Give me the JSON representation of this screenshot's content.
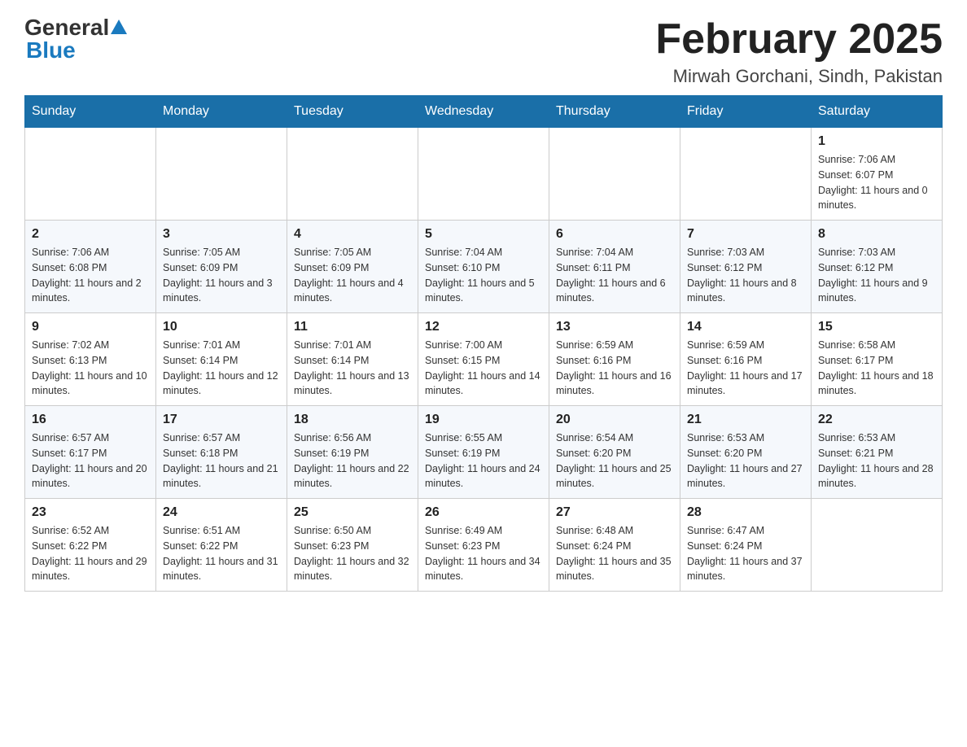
{
  "header": {
    "logo_general": "General",
    "logo_blue": "Blue",
    "title": "February 2025",
    "subtitle": "Mirwah Gorchani, Sindh, Pakistan"
  },
  "days_of_week": [
    "Sunday",
    "Monday",
    "Tuesday",
    "Wednesday",
    "Thursday",
    "Friday",
    "Saturday"
  ],
  "weeks": [
    [
      {
        "day": "",
        "info": ""
      },
      {
        "day": "",
        "info": ""
      },
      {
        "day": "",
        "info": ""
      },
      {
        "day": "",
        "info": ""
      },
      {
        "day": "",
        "info": ""
      },
      {
        "day": "",
        "info": ""
      },
      {
        "day": "1",
        "info": "Sunrise: 7:06 AM\nSunset: 6:07 PM\nDaylight: 11 hours and 0 minutes."
      }
    ],
    [
      {
        "day": "2",
        "info": "Sunrise: 7:06 AM\nSunset: 6:08 PM\nDaylight: 11 hours and 2 minutes."
      },
      {
        "day": "3",
        "info": "Sunrise: 7:05 AM\nSunset: 6:09 PM\nDaylight: 11 hours and 3 minutes."
      },
      {
        "day": "4",
        "info": "Sunrise: 7:05 AM\nSunset: 6:09 PM\nDaylight: 11 hours and 4 minutes."
      },
      {
        "day": "5",
        "info": "Sunrise: 7:04 AM\nSunset: 6:10 PM\nDaylight: 11 hours and 5 minutes."
      },
      {
        "day": "6",
        "info": "Sunrise: 7:04 AM\nSunset: 6:11 PM\nDaylight: 11 hours and 6 minutes."
      },
      {
        "day": "7",
        "info": "Sunrise: 7:03 AM\nSunset: 6:12 PM\nDaylight: 11 hours and 8 minutes."
      },
      {
        "day": "8",
        "info": "Sunrise: 7:03 AM\nSunset: 6:12 PM\nDaylight: 11 hours and 9 minutes."
      }
    ],
    [
      {
        "day": "9",
        "info": "Sunrise: 7:02 AM\nSunset: 6:13 PM\nDaylight: 11 hours and 10 minutes."
      },
      {
        "day": "10",
        "info": "Sunrise: 7:01 AM\nSunset: 6:14 PM\nDaylight: 11 hours and 12 minutes."
      },
      {
        "day": "11",
        "info": "Sunrise: 7:01 AM\nSunset: 6:14 PM\nDaylight: 11 hours and 13 minutes."
      },
      {
        "day": "12",
        "info": "Sunrise: 7:00 AM\nSunset: 6:15 PM\nDaylight: 11 hours and 14 minutes."
      },
      {
        "day": "13",
        "info": "Sunrise: 6:59 AM\nSunset: 6:16 PM\nDaylight: 11 hours and 16 minutes."
      },
      {
        "day": "14",
        "info": "Sunrise: 6:59 AM\nSunset: 6:16 PM\nDaylight: 11 hours and 17 minutes."
      },
      {
        "day": "15",
        "info": "Sunrise: 6:58 AM\nSunset: 6:17 PM\nDaylight: 11 hours and 18 minutes."
      }
    ],
    [
      {
        "day": "16",
        "info": "Sunrise: 6:57 AM\nSunset: 6:17 PM\nDaylight: 11 hours and 20 minutes."
      },
      {
        "day": "17",
        "info": "Sunrise: 6:57 AM\nSunset: 6:18 PM\nDaylight: 11 hours and 21 minutes."
      },
      {
        "day": "18",
        "info": "Sunrise: 6:56 AM\nSunset: 6:19 PM\nDaylight: 11 hours and 22 minutes."
      },
      {
        "day": "19",
        "info": "Sunrise: 6:55 AM\nSunset: 6:19 PM\nDaylight: 11 hours and 24 minutes."
      },
      {
        "day": "20",
        "info": "Sunrise: 6:54 AM\nSunset: 6:20 PM\nDaylight: 11 hours and 25 minutes."
      },
      {
        "day": "21",
        "info": "Sunrise: 6:53 AM\nSunset: 6:20 PM\nDaylight: 11 hours and 27 minutes."
      },
      {
        "day": "22",
        "info": "Sunrise: 6:53 AM\nSunset: 6:21 PM\nDaylight: 11 hours and 28 minutes."
      }
    ],
    [
      {
        "day": "23",
        "info": "Sunrise: 6:52 AM\nSunset: 6:22 PM\nDaylight: 11 hours and 29 minutes."
      },
      {
        "day": "24",
        "info": "Sunrise: 6:51 AM\nSunset: 6:22 PM\nDaylight: 11 hours and 31 minutes."
      },
      {
        "day": "25",
        "info": "Sunrise: 6:50 AM\nSunset: 6:23 PM\nDaylight: 11 hours and 32 minutes."
      },
      {
        "day": "26",
        "info": "Sunrise: 6:49 AM\nSunset: 6:23 PM\nDaylight: 11 hours and 34 minutes."
      },
      {
        "day": "27",
        "info": "Sunrise: 6:48 AM\nSunset: 6:24 PM\nDaylight: 11 hours and 35 minutes."
      },
      {
        "day": "28",
        "info": "Sunrise: 6:47 AM\nSunset: 6:24 PM\nDaylight: 11 hours and 37 minutes."
      },
      {
        "day": "",
        "info": ""
      }
    ]
  ]
}
